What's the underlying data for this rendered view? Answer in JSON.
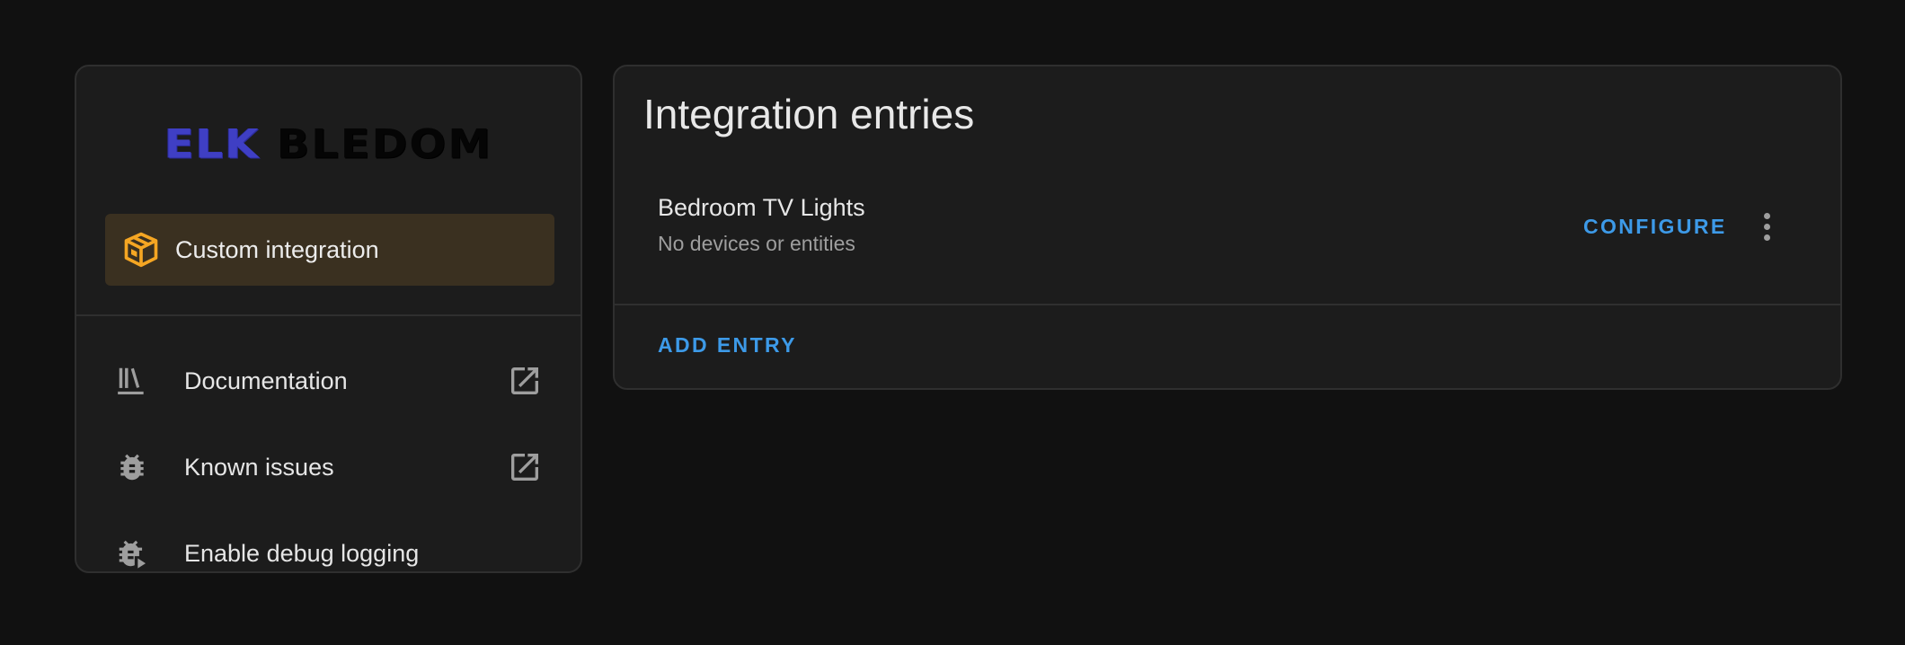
{
  "brand": {
    "logo_part1": "ELK",
    "logo_part2": "BLEDOM",
    "logo_part1_color": "#3f3fc4",
    "logo_part2_color": "#050505"
  },
  "info_card": {
    "badge": {
      "icon": "package-icon",
      "label": "Custom integration",
      "color": "#f5a623"
    },
    "links": [
      {
        "icon": "bookshelf-icon",
        "label": "Documentation",
        "external": true
      },
      {
        "icon": "bug-icon",
        "label": "Known issues",
        "external": true
      },
      {
        "icon": "bug-play-icon",
        "label": "Enable debug logging",
        "external": false
      }
    ]
  },
  "entries_card": {
    "title": "Integration entries",
    "entries": [
      {
        "name": "Bedroom TV Lights",
        "subtitle": "No devices or entities",
        "configure_label": "CONFIGURE",
        "menu_icon": "dots-vertical-icon"
      }
    ],
    "add_entry_label": "ADD ENTRY"
  },
  "colors": {
    "background": "#111111",
    "card": "#1c1c1c",
    "accent": "#3d9ae8",
    "badge_bg": "#3a3020"
  }
}
